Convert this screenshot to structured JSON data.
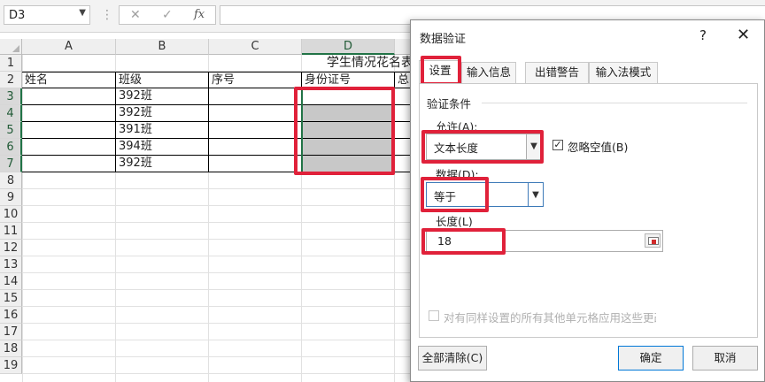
{
  "formula_bar": {
    "name_box": "D3",
    "name_dropdown_icon": "chevron-down-icon",
    "cancel_glyph": "✕",
    "enter_glyph": "✓",
    "fx_label": "fx",
    "formula": ""
  },
  "sheet": {
    "columns": [
      "A",
      "B",
      "C",
      "D"
    ],
    "selected_column": "D",
    "selected_cell": "D3",
    "rows": [
      "1",
      "2",
      "3",
      "4",
      "5",
      "6",
      "7",
      "8",
      "9",
      "10",
      "11",
      "12",
      "13",
      "14",
      "15",
      "16",
      "17",
      "18",
      "19"
    ],
    "title": "学生情况花名表",
    "headers": [
      "姓名",
      "班级",
      "序号",
      "身份证号",
      "总"
    ],
    "data": [
      {
        "name": "",
        "class": "392班",
        "seq": "",
        "id": ""
      },
      {
        "name": "",
        "class": "392班",
        "seq": "",
        "id": ""
      },
      {
        "name": "",
        "class": "391班",
        "seq": "",
        "id": ""
      },
      {
        "name": "",
        "class": "394班",
        "seq": "",
        "id": ""
      },
      {
        "name": "",
        "class": "392班",
        "seq": "",
        "id": ""
      }
    ],
    "highlight_color": "#e0213a"
  },
  "dialog": {
    "title": "数据验证",
    "help": "?",
    "close": "✕",
    "tabs": [
      {
        "label": "设置",
        "active": true
      },
      {
        "label": "输入信息",
        "active": false
      },
      {
        "label": "出错警告",
        "active": false
      },
      {
        "label": "输入法模式",
        "active": false
      }
    ],
    "group_label": "验证条件",
    "allow_label": "允许(A):",
    "allow_value": "文本长度",
    "ignore_blank_label": "忽略空值(B)",
    "ignore_blank_checked": true,
    "data_label": "数据(D):",
    "data_value": "等于",
    "length_label": "长度(L)",
    "length_value": "18",
    "apply_all_label": "对有同样设置的所有其他单元格应用这些更改",
    "apply_all_checked": false,
    "clear_all": "全部清除(C)",
    "ok": "确定",
    "cancel": "取消"
  }
}
